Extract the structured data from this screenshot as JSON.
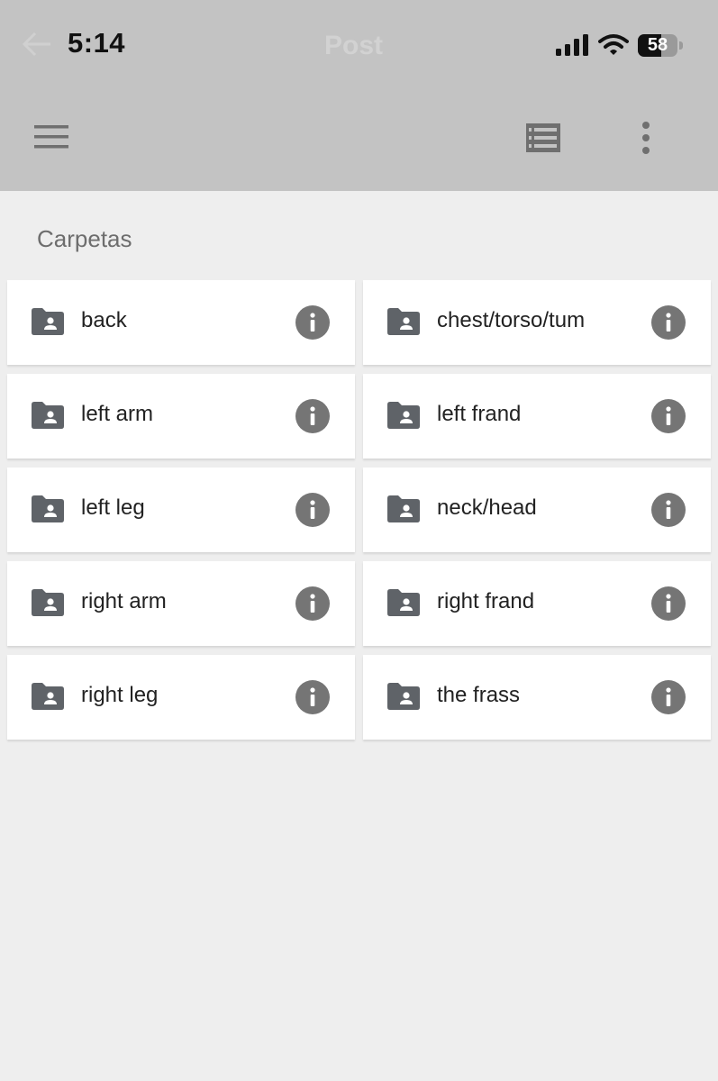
{
  "status_bar": {
    "time": "5:14",
    "battery": "58",
    "battery_fill_fraction": 0.58,
    "behind_title": "Post"
  },
  "toolbar": {
    "menu_icon": "hamburger-menu-icon",
    "view_icon": "list-view-icon",
    "more_icon": "more-vert-icon"
  },
  "section": {
    "title": "Carpetas"
  },
  "folders": [
    {
      "label": "back"
    },
    {
      "label": "chest/torso/tum"
    },
    {
      "label": "left arm"
    },
    {
      "label": "left frand"
    },
    {
      "label": "left leg"
    },
    {
      "label": "neck/head"
    },
    {
      "label": "right arm"
    },
    {
      "label": "right frand"
    },
    {
      "label": "right leg"
    },
    {
      "label": "the frass"
    }
  ],
  "colors": {
    "app_bar": "#c3c3c3",
    "background": "#eeeeee",
    "card": "#ffffff",
    "icon_folder": "#5f6368",
    "icon_info": "#757575"
  }
}
